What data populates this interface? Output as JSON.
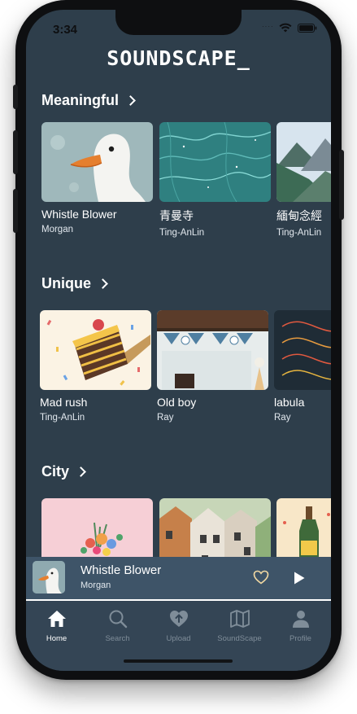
{
  "status": {
    "time": "3:34",
    "dots": "····"
  },
  "app": {
    "logo": "SOUNDSCAPE_"
  },
  "sections": [
    {
      "title": "Meaningful",
      "items": [
        {
          "track": "Whistle Blower",
          "artist": "Morgan"
        },
        {
          "track": "青曼寺",
          "artist": "Ting-AnLin"
        },
        {
          "track": "緬甸念經",
          "artist": "Ting-AnLin"
        }
      ]
    },
    {
      "title": "Unique",
      "items": [
        {
          "track": "Mad rush",
          "artist": "Ting-AnLin"
        },
        {
          "track": "Old boy",
          "artist": "Ray"
        },
        {
          "track": "labula",
          "artist": "Ray"
        }
      ]
    },
    {
      "title": "City",
      "items": []
    }
  ],
  "player": {
    "track": "Whistle Blower",
    "artist": "Morgan"
  },
  "tabs": [
    {
      "label": "Home",
      "icon": "home-icon",
      "active": true
    },
    {
      "label": "Search",
      "icon": "search-icon",
      "active": false
    },
    {
      "label": "Upload",
      "icon": "upload-icon",
      "active": false
    },
    {
      "label": "SoundScape",
      "icon": "map-icon",
      "active": false
    },
    {
      "label": "Profile",
      "icon": "profile-icon",
      "active": false
    }
  ],
  "colors": {
    "background": "#2e3e4b",
    "player": "#3e5468",
    "tabbar": "#344555",
    "tab_inactive": "#7f8d99"
  }
}
